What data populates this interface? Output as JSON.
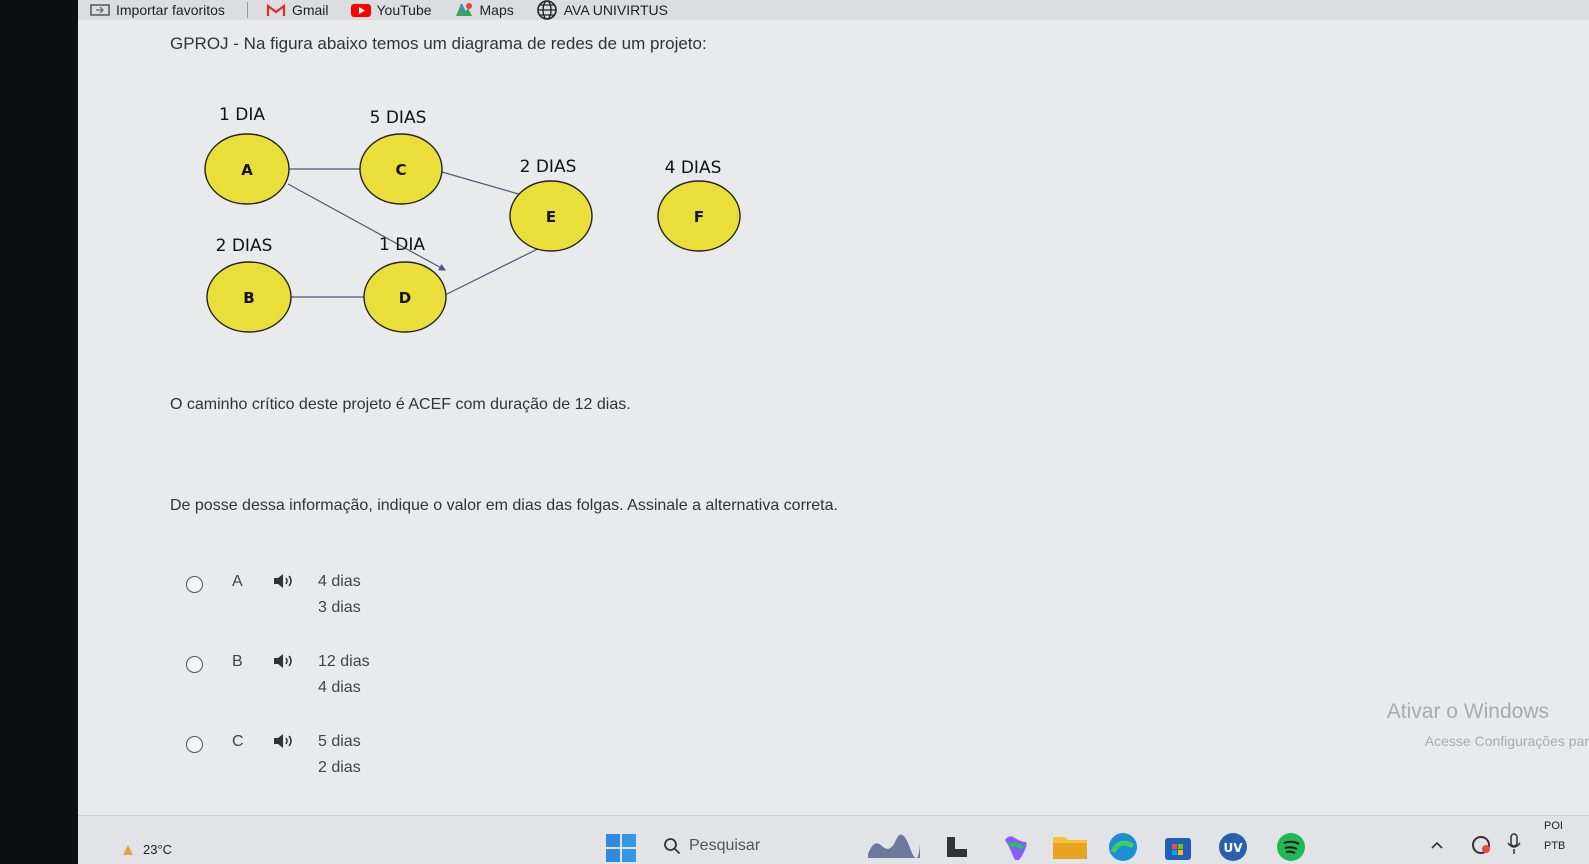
{
  "bookmarks": [
    {
      "label": "Importar favoritos",
      "icon": "import-icon",
      "color": "#555555"
    },
    {
      "label": "Gmail",
      "icon": "gmail-icon",
      "color": "#d93025"
    },
    {
      "label": "YouTube",
      "icon": "youtube-icon",
      "color": "#ff0000"
    },
    {
      "label": "Maps",
      "icon": "maps-icon",
      "color": "#34a853"
    },
    {
      "label": "AVA UNIVIRTUS",
      "icon": "globe-icon",
      "color": "#333333"
    }
  ],
  "question": {
    "title": "GPROJ - Na figura abaixo temos um diagrama de redes de um projeto:",
    "statement": "O caminho crítico deste projeto é ACEF com duração de 12 dias.",
    "instruction": "De posse dessa informação, indique o valor em dias das folgas. Assinale a alternativa correta."
  },
  "diagram": {
    "node_color": "#eadf3a",
    "nodes": [
      {
        "id": "A",
        "duration": "1 DIA"
      },
      {
        "id": "C",
        "duration": "5 DIAS"
      },
      {
        "id": "B",
        "duration": "2 DIAS"
      },
      {
        "id": "D",
        "duration": "1 DIA"
      },
      {
        "id": "E",
        "duration": "2 DIAS"
      },
      {
        "id": "F",
        "duration": "4 DIAS"
      }
    ]
  },
  "options": [
    {
      "letter": "A",
      "line1": "4 dias",
      "line2": "3 dias"
    },
    {
      "letter": "B",
      "line1": "12 dias",
      "line2": "4 dias"
    },
    {
      "letter": "C",
      "line1": "5 dias",
      "line2": "2 dias"
    }
  ],
  "watermark": {
    "title": "Ativar o Windows",
    "subtitle": "Acesse Configurações par"
  },
  "taskbar": {
    "temperature": "23°C",
    "search_placeholder": "Pesquisar",
    "tray_top": "POI",
    "tray_bottom": "PTB"
  }
}
